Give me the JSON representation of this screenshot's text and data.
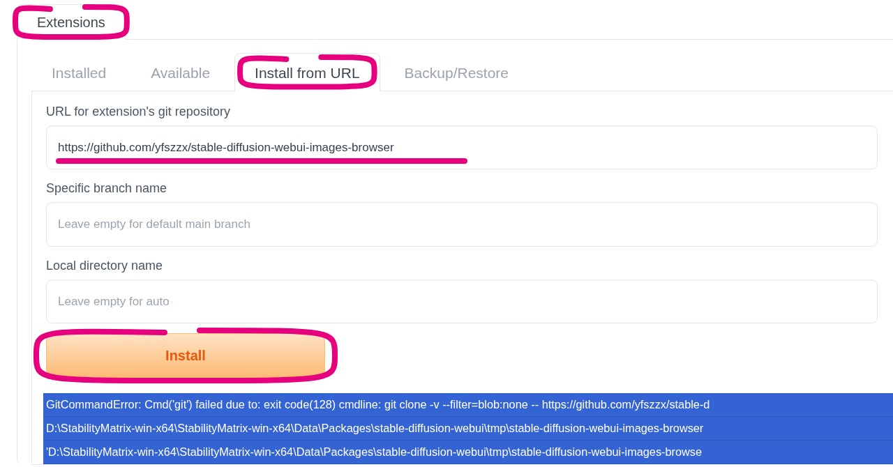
{
  "section_tab": {
    "label": "Extensions",
    "selected": true
  },
  "tabs": [
    {
      "label": "Installed",
      "selected": false
    },
    {
      "label": "Available",
      "selected": false
    },
    {
      "label": "Install from URL",
      "selected": true
    },
    {
      "label": "Backup/Restore",
      "selected": false
    }
  ],
  "fields": [
    {
      "label": "URL for extension's git repository",
      "value": "https://github.com/yfszzx/stable-diffusion-webui-images-browser"
    },
    {
      "label": "Specific branch name",
      "placeholder": "Leave empty for default main branch"
    },
    {
      "label": "Local directory name",
      "placeholder": "Leave empty for auto"
    }
  ],
  "install_button": {
    "label": "Install"
  },
  "output": {
    "selected": true,
    "lines": [
      "GitCommandError: Cmd('git') failed due to: exit code(128) cmdline: git clone -v --filter=blob:none -- https://github.com/yfszzx/stable-d",
      "D:\\StabilityMatrix-win-x64\\StabilityMatrix-win-x64\\Data\\Packages\\stable-diffusion-webui\\tmp\\stable-diffusion-webui-images-browser",
      "'D:\\StabilityMatrix-win-x64\\StabilityMatrix-win-x64\\Data\\Packages\\stable-diffusion-webui\\tmp\\stable-diffusion-webui-images-browse"
    ]
  }
}
